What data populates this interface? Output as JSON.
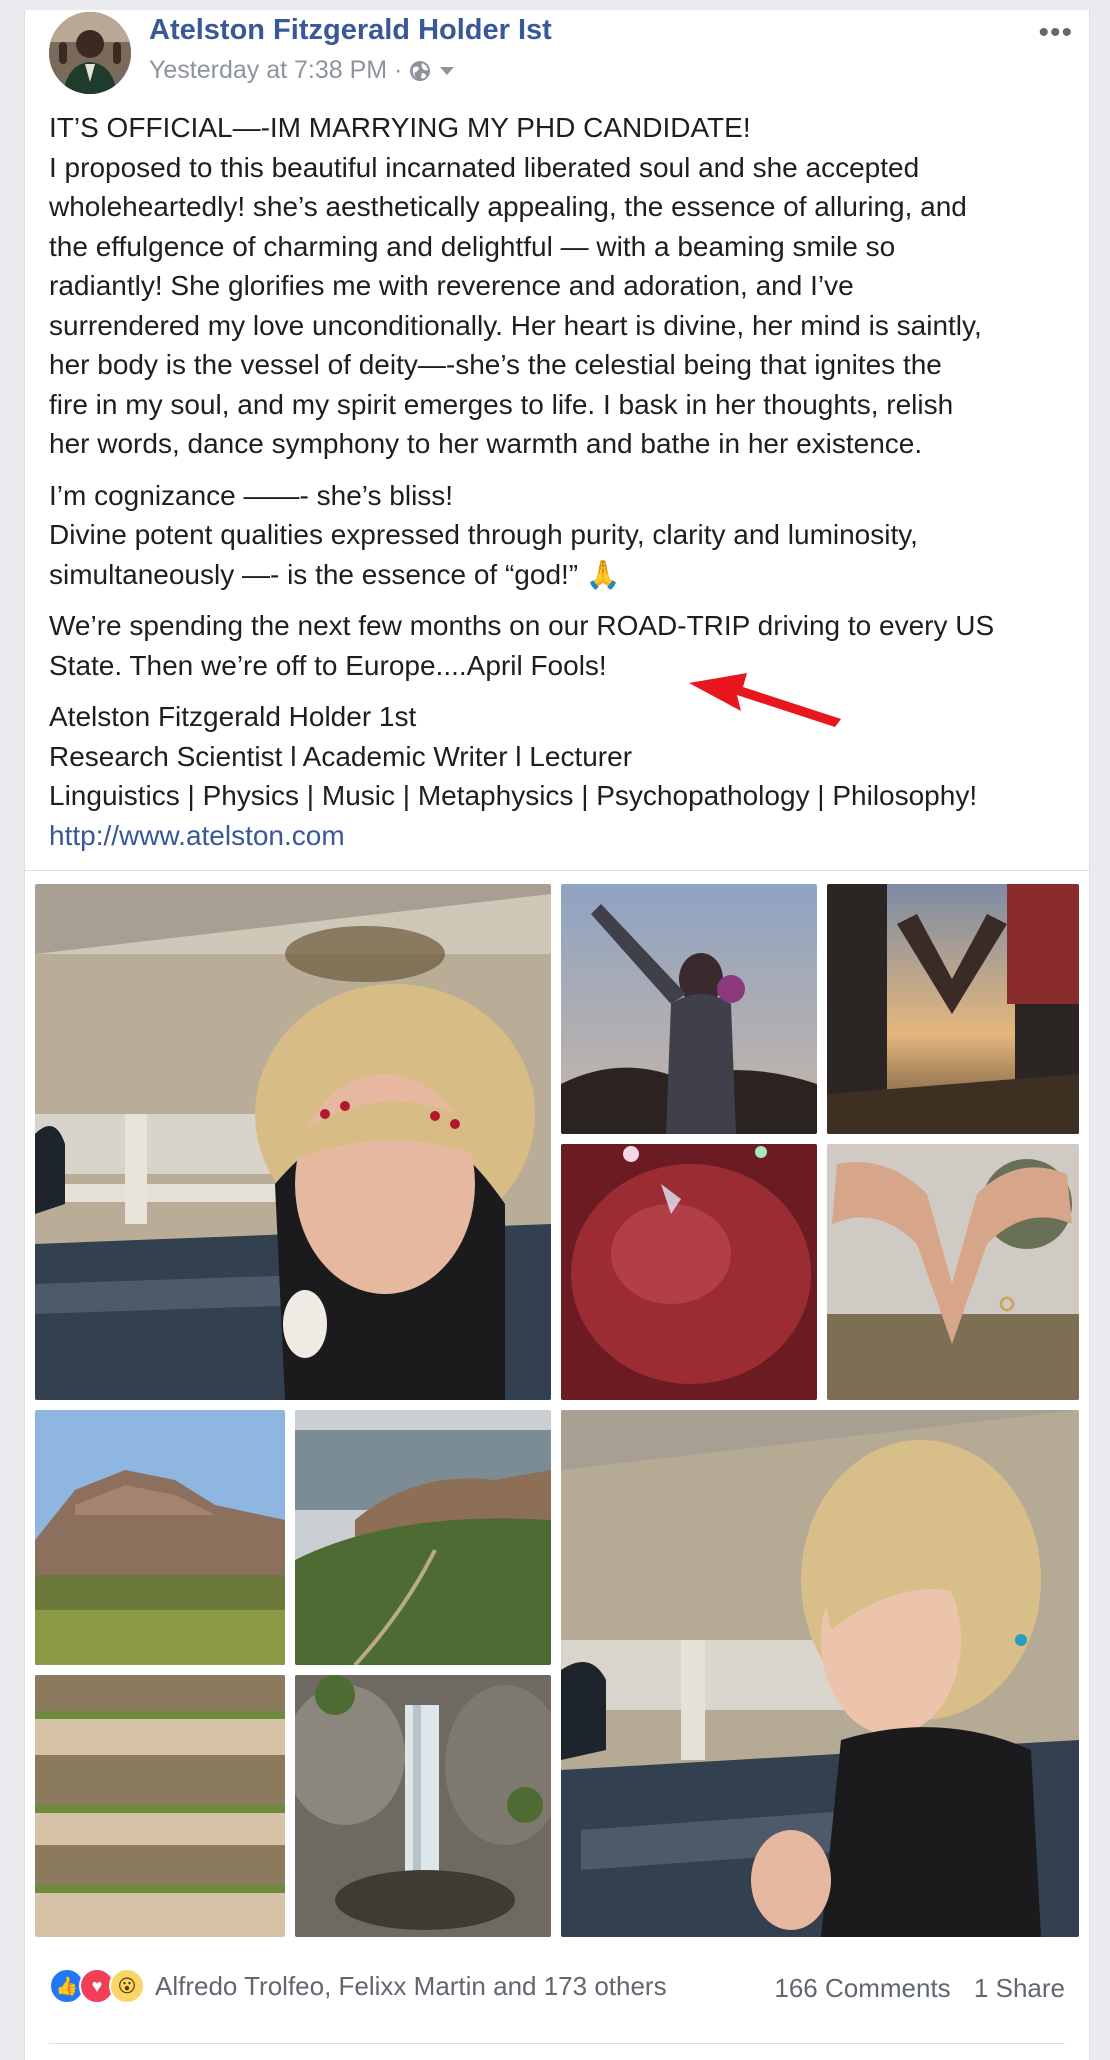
{
  "post": {
    "author": "Atelston Fitzgerald Holder Ist",
    "timestamp": "Yesterday at 7:38 PM ·",
    "privacy_icon": "globe-icon",
    "more_icon": "more-options-icon",
    "text": {
      "p1": [
        "IT’S OFFICIAL—-IM MARRYING MY PHD CANDIDATE!",
        "I proposed to this beautiful incarnated liberated soul and she accepted",
        "wholeheartedly! she’s aesthetically appealing, the essence of alluring, and",
        "the effulgence of charming and delightful — with a beaming smile so",
        "radiantly! She glorifies me with reverence and adoration, and I’ve",
        "surrendered my love unconditionally. Her heart is divine, her mind is saintly,",
        "her body is the vessel of deity—-she’s the celestial being that ignites the",
        "fire in my soul, and my spirit emerges to life. I bask in her thoughts, relish",
        "her words, dance symphony to her warmth and bathe in her existence."
      ],
      "p2": [
        "I’m cognizance ——- she’s bliss!",
        "Divine potent qualities expressed through purity, clarity and luminosity,",
        "simultaneously —- is the essence of “god!” 🙏"
      ],
      "p3": [
        "We’re spending the next few months on our ROAD-TRIP driving to every US",
        "State. Then we’re off to Europe....April Fools!"
      ],
      "p4": [
        "Atelston Fitzgerald Holder 1st",
        "Research Scientist l Academic Writer l Lecturer",
        "Linguistics | Physics | Music | Metaphysics | Psychopathology | Philosophy!"
      ],
      "link": "http://www.atelston.com"
    }
  },
  "photos": [
    {
      "name": "photo-woman-covering-face-in-car"
    },
    {
      "name": "photo-couple-on-hill-at-dusk"
    },
    {
      "name": "photo-hands-heart-sunset"
    },
    {
      "name": "photo-red-blurry"
    },
    {
      "name": "photo-hands-heart-ring"
    },
    {
      "name": "photo-mesa-landscape"
    },
    {
      "name": "photo-coastal-cliffs"
    },
    {
      "name": "photo-wooden-steps-love"
    },
    {
      "name": "photo-waterfall"
    },
    {
      "name": "photo-woman-smiling-in-car"
    }
  ],
  "footer": {
    "reactions_text": "Alfredo Trolfeo, Felixx Martin and 173 others",
    "comments": "166 Comments",
    "shares": "1 Share",
    "reaction_icons": [
      "like-icon",
      "love-icon",
      "wow-icon"
    ]
  },
  "colors": {
    "author": "#385898",
    "link": "#385898",
    "annotation_arrow": "#e8161e"
  }
}
